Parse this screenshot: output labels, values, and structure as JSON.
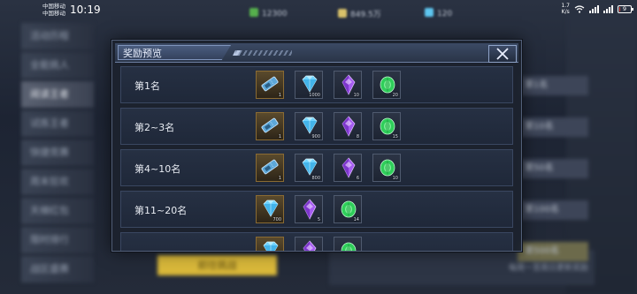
{
  "status_bar": {
    "carrier_1": "中国移动",
    "carrier_2": "中国移动",
    "time": "10:19",
    "resource_1": "12300",
    "resource_2": "849.5万",
    "resource_3": "120",
    "net_speed_value": "1.7",
    "net_speed_unit": "K/s",
    "battery": "9"
  },
  "background": {
    "left_menu": [
      "活动历程",
      "全能挑人",
      "阅读王者",
      "试炼王者",
      "快捷竞赛",
      "周末狂欢",
      "天梯红包",
      "限时排行",
      "战区盛赛"
    ],
    "right_chips": [
      "第1名",
      "第10名",
      "第50名",
      "第100名",
      "第500名"
    ],
    "go_button": "前往挑战",
    "bottom_tip": "每周一至周日更新奖励"
  },
  "dialog": {
    "title": "奖励预览",
    "close_label": "×",
    "rows": [
      {
        "label": "第1名",
        "items": [
          {
            "icon": "ticket-icon",
            "qty": "1",
            "rare": true
          },
          {
            "icon": "diamond-icon",
            "qty": "1000",
            "rare": false
          },
          {
            "icon": "purple-crystal-icon",
            "qty": "10",
            "rare": false
          },
          {
            "icon": "green-gem-icon",
            "qty": "20",
            "rare": false
          }
        ]
      },
      {
        "label": "第2~3名",
        "items": [
          {
            "icon": "ticket-icon",
            "qty": "1",
            "rare": true
          },
          {
            "icon": "diamond-icon",
            "qty": "900",
            "rare": false
          },
          {
            "icon": "purple-crystal-icon",
            "qty": "8",
            "rare": false
          },
          {
            "icon": "green-gem-icon",
            "qty": "15",
            "rare": false
          }
        ]
      },
      {
        "label": "第4~10名",
        "items": [
          {
            "icon": "ticket-icon",
            "qty": "1",
            "rare": true
          },
          {
            "icon": "diamond-icon",
            "qty": "800",
            "rare": false
          },
          {
            "icon": "purple-crystal-icon",
            "qty": "6",
            "rare": false
          },
          {
            "icon": "green-gem-icon",
            "qty": "10",
            "rare": false
          }
        ]
      },
      {
        "label": "第11~20名",
        "items": [
          {
            "icon": "diamond-icon",
            "qty": "700",
            "rare": true
          },
          {
            "icon": "purple-crystal-icon",
            "qty": "5",
            "rare": false
          },
          {
            "icon": "green-gem-icon",
            "qty": "14",
            "rare": false
          }
        ]
      },
      {
        "label": "",
        "items": [
          {
            "icon": "diamond-icon",
            "qty": "",
            "rare": true
          },
          {
            "icon": "purple-crystal-icon",
            "qty": "",
            "rare": false
          },
          {
            "icon": "green-gem-icon",
            "qty": "",
            "rare": false
          }
        ]
      }
    ]
  },
  "colors": {
    "accent": "#7f94bb",
    "diamond": "#6fd3ff",
    "purple": "#a55cf0",
    "green": "#2fce5a",
    "gold_button": "#d9b83a"
  }
}
